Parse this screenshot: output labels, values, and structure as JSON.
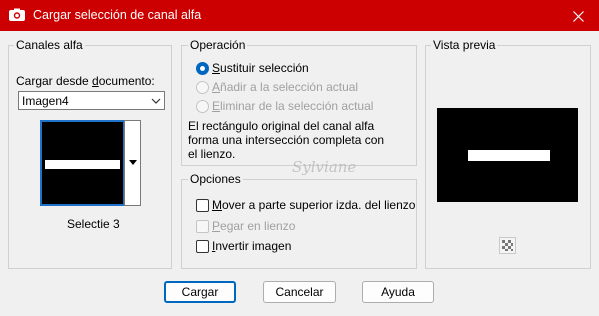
{
  "window": {
    "title": "Cargar selección de canal alfa",
    "title_bar_color": "#cc0000",
    "icon": "camera-icon",
    "close_icon": "close-icon"
  },
  "canales_alfa": {
    "group_label": "Canales alfa",
    "load_from_label_pre": "Cargar desde ",
    "load_from_label_accel": "d",
    "load_from_label_post": "ocumento:",
    "document_selected": "Imagen4",
    "channel_name": "Selectie 3"
  },
  "operacion": {
    "group_label": "Operación",
    "options": [
      {
        "accel": "S",
        "rest": "ustituir selección",
        "checked": true,
        "disabled": false
      },
      {
        "accel": "A",
        "rest": "ñadir a la selección actual",
        "checked": false,
        "disabled": true
      },
      {
        "accel": "E",
        "rest": "liminar de la selección actual",
        "checked": false,
        "disabled": true
      }
    ],
    "description_lines": [
      "El rectángulo original del canal alfa",
      "forma una intersección completa con",
      "el lienzo."
    ]
  },
  "opciones": {
    "group_label": "Opciones",
    "items": [
      {
        "accel": "M",
        "rest": "over a parte superior izda. del lienzo",
        "checked": false,
        "disabled": false
      },
      {
        "accel": "P",
        "rest": "egar en lienzo",
        "checked": false,
        "disabled": true
      },
      {
        "accel": "I",
        "rest": "nvertir imagen",
        "checked": false,
        "disabled": false
      }
    ]
  },
  "vista_previa": {
    "group_label": "Vista previa",
    "zoom_icon": "checker-zoom-icon"
  },
  "watermark": "Sylviane",
  "buttons": {
    "load": "Cargar",
    "cancel": "Cancelar",
    "help": "Ayuda"
  },
  "accent_color": "#0067c0"
}
